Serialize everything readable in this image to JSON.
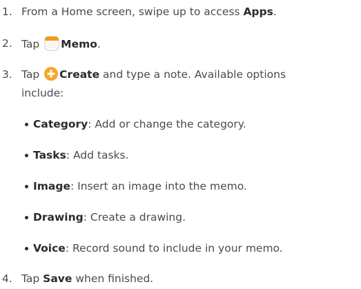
{
  "steps": [
    {
      "num": "1.",
      "text": "From a Home screen, swipe up to access ",
      "bold": "Apps",
      "end": "."
    },
    {
      "num": "2.",
      "pre": "Tap ",
      "bold": "Memo",
      "end": "."
    },
    {
      "num": "3.",
      "pre": "Tap ",
      "bold": "Create",
      "post": " and type a note. Available options",
      "cont": "include:"
    },
    {
      "num": "4.",
      "pre": "Tap ",
      "bold": "Save",
      "post": " when finished."
    }
  ],
  "options": [
    {
      "label": "Category",
      "desc": ": Add or change the category."
    },
    {
      "label": "Tasks",
      "desc": ": Add tasks."
    },
    {
      "label": "Image",
      "desc": ": Insert an image into the memo."
    },
    {
      "label": "Drawing",
      "desc": ": Create a drawing."
    },
    {
      "label": "Voice",
      "desc": ": Record sound to include in your memo."
    }
  ],
  "icons": {
    "memo": "memo-app-icon",
    "create": "create-plus-icon",
    "create_color": "#f5a623",
    "memo_color": "#f39c12"
  }
}
